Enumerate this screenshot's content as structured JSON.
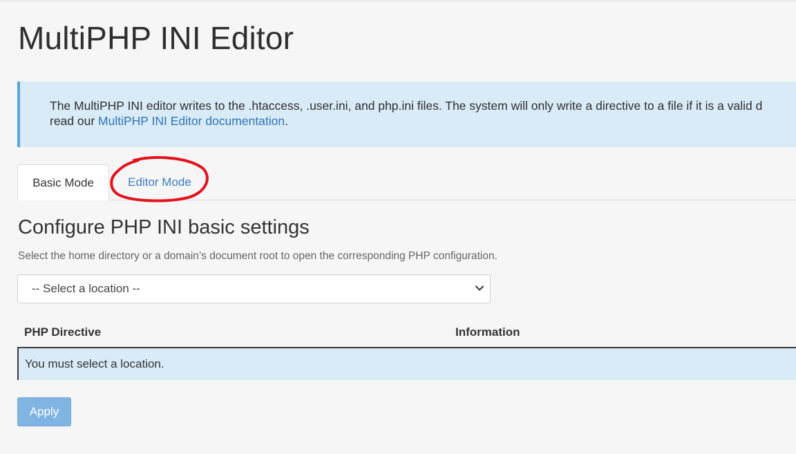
{
  "page": {
    "title": "MultiPHP INI Editor"
  },
  "notice": {
    "text": "The MultiPHP INI editor writes to the .htaccess, .user.ini, and php.ini files. The system will only write a directive to a file if it is a valid d",
    "text2_prefix": "read our ",
    "link_label": "MultiPHP INI Editor documentation",
    "text2_suffix": "."
  },
  "tabs": [
    {
      "label": "Basic Mode",
      "active": true
    },
    {
      "label": "Editor Mode",
      "active": false
    }
  ],
  "annotation": {
    "color": "#e3121b"
  },
  "section": {
    "title": "Configure PHP INI basic settings",
    "description": "Select the home directory or a domain’s document root to open the corresponding PHP configuration."
  },
  "location_select": {
    "selected": "-- Select a location --"
  },
  "table": {
    "columns": [
      "PHP Directive",
      "Information"
    ],
    "empty_message": "You must select a location."
  },
  "actions": {
    "apply_label": "Apply"
  },
  "colors": {
    "accent": "#3b7bbf",
    "info_bg": "#d9ebf7",
    "info_border": "#55a7d9",
    "apply_bg": "#80b4e2"
  }
}
